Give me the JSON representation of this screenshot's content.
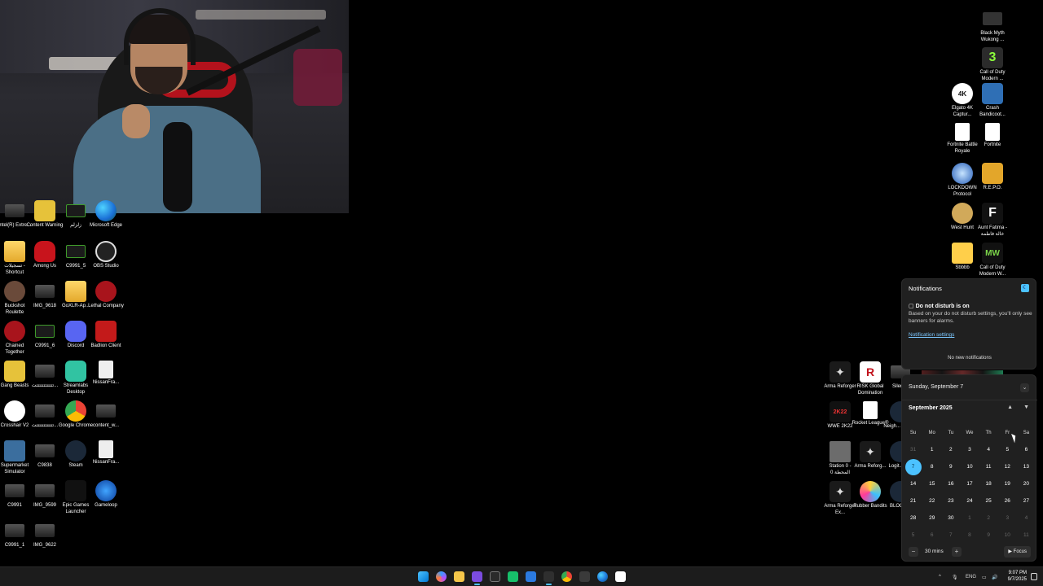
{
  "desktop": {
    "left_icons": [
      {
        "label": "Intel(R) Extre...",
        "icon": "intel-icon",
        "cls": "thumb"
      },
      {
        "label": "Content Warning",
        "icon": "content-warning-icon",
        "cls": "gang"
      },
      {
        "label": "زلزلم",
        "icon": "app-icon",
        "cls": "c99"
      },
      {
        "label": "Microsoft Edge",
        "icon": "edge-icon",
        "cls": "edge"
      },
      {
        "label": "تسجيلات - Shortcut",
        "icon": "folder-icon",
        "cls": "folder"
      },
      {
        "label": "Among Us",
        "icon": "among-us-icon",
        "cls": "amongus"
      },
      {
        "label": "C9991_5",
        "icon": "video-icon",
        "cls": "c99"
      },
      {
        "label": "OBS Studio",
        "icon": "obs-icon",
        "cls": "obs"
      },
      {
        "label": "Buckshot Roulette",
        "icon": "buckshot-icon",
        "cls": "buck"
      },
      {
        "label": "IMG_9618",
        "icon": "image-icon",
        "cls": "thumb"
      },
      {
        "label": "GoXLR-Ap...",
        "icon": "folder-icon",
        "cls": "folder"
      },
      {
        "label": "Lethal Company",
        "icon": "lethal-company-icon",
        "cls": "red"
      },
      {
        "label": "Chained Together",
        "icon": "chained-together-icon",
        "cls": "red"
      },
      {
        "label": "C9991_6",
        "icon": "video-icon",
        "cls": "c99"
      },
      {
        "label": "Discord",
        "icon": "discord-icon",
        "cls": "discord"
      },
      {
        "label": "Badlion Client",
        "icon": "badlion-icon",
        "cls": "badlion"
      },
      {
        "label": "Gang Beasts",
        "icon": "gang-beasts-icon",
        "cls": "gang"
      },
      {
        "label": "تتتتتتتتتتتتت...",
        "icon": "image-icon",
        "cls": "thumb"
      },
      {
        "label": "Streamlabs Desktop",
        "icon": "streamlabs-icon",
        "cls": "streamlabs"
      },
      {
        "label": "NissanFra...",
        "icon": "file-icon",
        "cls": "blank"
      },
      {
        "label": "Crosshair V2",
        "icon": "crosshair-icon",
        "cls": "xhair"
      },
      {
        "label": "تتتتتتتتتتتتت...",
        "icon": "image-icon",
        "cls": "thumb"
      },
      {
        "label": "Google Chrome",
        "icon": "chrome-icon",
        "cls": "chrome"
      },
      {
        "label": "content_w...",
        "icon": "image-icon",
        "cls": "thumb"
      },
      {
        "label": "Supermarket Simulator",
        "icon": "supermarket-icon",
        "cls": "supermarket"
      },
      {
        "label": "C9838",
        "icon": "image-icon",
        "cls": "thumb"
      },
      {
        "label": "Steam",
        "icon": "steam-icon",
        "cls": "steam"
      },
      {
        "label": "NissanFra...",
        "icon": "file-icon",
        "cls": "blank"
      },
      {
        "label": "C9991",
        "icon": "video-icon",
        "cls": "thumb"
      },
      {
        "label": "IMG_9599",
        "icon": "image-icon",
        "cls": "thumb"
      },
      {
        "label": "Epic Games Launcher",
        "icon": "epic-games-icon",
        "cls": "epic"
      },
      {
        "label": "Gameloop",
        "icon": "gameloop-icon",
        "cls": "gameloop"
      },
      {
        "label": "C9991_1",
        "icon": "video-icon",
        "cls": "thumb"
      },
      {
        "label": "IMG_9622",
        "icon": "image-icon",
        "cls": "thumb"
      }
    ],
    "right_icons": [
      {
        "label": "Black Myth Wukong ...",
        "icon": "wukong-icon",
        "cls": "wukong"
      },
      {
        "label": "Call of Duty Modern ...",
        "icon": "cod-icon",
        "cls": "cod",
        "glyph": "3"
      },
      {
        "label": "Elgato 4K Captur...",
        "icon": "elgato-icon",
        "cls": "elgato",
        "glyph": "4K"
      },
      {
        "label": "Crash Bandicoot...",
        "icon": "crash-icon",
        "cls": "crash"
      },
      {
        "label": "Fortnite Battle Royale",
        "icon": "file-icon",
        "cls": "file"
      },
      {
        "label": "Fortnite",
        "icon": "file-icon",
        "cls": "file"
      },
      {
        "label": "LOCKDOWN Protocol",
        "icon": "lockdown-icon",
        "cls": "lockdown"
      },
      {
        "label": "R.E.P.O.",
        "icon": "repo-icon",
        "cls": "repo"
      },
      {
        "label": "West Hunt",
        "icon": "west-hunt-icon",
        "cls": "westhunt"
      },
      {
        "label": "Aunt Fatima - خالة فاطمة",
        "icon": "aunt-fatima-icon",
        "cls": "fatima",
        "glyph": "F"
      },
      {
        "label": "Sbbbb",
        "icon": "folder-icon",
        "cls": "sbbb"
      },
      {
        "label": "Call of Duty Modern W...",
        "icon": "mw-icon",
        "cls": "mw",
        "glyph": "MW"
      }
    ],
    "games_cluster": [
      {
        "label": "Arma Reforger",
        "icon": "arma-icon",
        "cls": "arma",
        "glyph": "✦"
      },
      {
        "label": "RISK Global Domination",
        "icon": "risk-icon",
        "cls": "risk",
        "glyph": "R"
      },
      {
        "label": "Silent...",
        "icon": "silent-icon",
        "cls": "thumb"
      },
      {
        "label": "WWE 2K22",
        "icon": "wwe-icon",
        "cls": "wwe",
        "glyph": "2K22"
      },
      {
        "label": "Rocket League®",
        "icon": "file-icon",
        "cls": "rocket"
      },
      {
        "label": "Neigh... Subu...",
        "icon": "app-icon",
        "cls": "steam"
      },
      {
        "label": "Station 0 - المحطة 0",
        "icon": "station-icon",
        "cls": "station"
      },
      {
        "label": "Arma Reforg...",
        "icon": "arma-icon",
        "cls": "arma",
        "glyph": "✦"
      },
      {
        "label": "Logit... H...",
        "icon": "logitech-icon",
        "cls": "steam"
      },
      {
        "label": "Arma Reforger Ex...",
        "icon": "arma-icon",
        "cls": "arma",
        "glyph": "✦"
      },
      {
        "label": "Rubber Bandits",
        "icon": "rubber-bandits-icon",
        "cls": "rubber"
      },
      {
        "label": "BLOOD...",
        "icon": "blood-icon",
        "cls": "steam"
      }
    ]
  },
  "notifications": {
    "title": "Notifications",
    "dnd_heading": "Do not disturb is on",
    "dnd_body": "Based on your do not disturb settings, you'll only see banners for alarms.",
    "settings_link": "Notification settings",
    "empty_text": "No new notifications"
  },
  "calendar": {
    "date_heading": "Sunday, September 7",
    "month_label": "September 2025",
    "days_of_week": [
      "Su",
      "Mo",
      "Tu",
      "We",
      "Th",
      "Fr",
      "Sa"
    ],
    "weeks": [
      [
        "31",
        "1",
        "2",
        "3",
        "4",
        "5",
        "6"
      ],
      [
        "7",
        "8",
        "9",
        "10",
        "11",
        "12",
        "13"
      ],
      [
        "14",
        "15",
        "16",
        "17",
        "18",
        "19",
        "20"
      ],
      [
        "21",
        "22",
        "23",
        "24",
        "25",
        "26",
        "27"
      ],
      [
        "28",
        "29",
        "30",
        "1",
        "2",
        "3",
        "4"
      ],
      [
        "5",
        "6",
        "7",
        "8",
        "9",
        "10",
        "11"
      ]
    ],
    "today": "7",
    "focus_minus": "−",
    "focus_duration": "30 mins",
    "focus_plus": "+",
    "focus_button": "▶ Focus"
  },
  "taskbar": {
    "language": "ENG",
    "time": "9:07 PM",
    "date": "9/7/2025",
    "tray_chevron": "^"
  },
  "colors": {
    "accent": "#4cc2ff",
    "panel_bg": "#202020",
    "taskbar_bg": "#1c1c1c"
  }
}
